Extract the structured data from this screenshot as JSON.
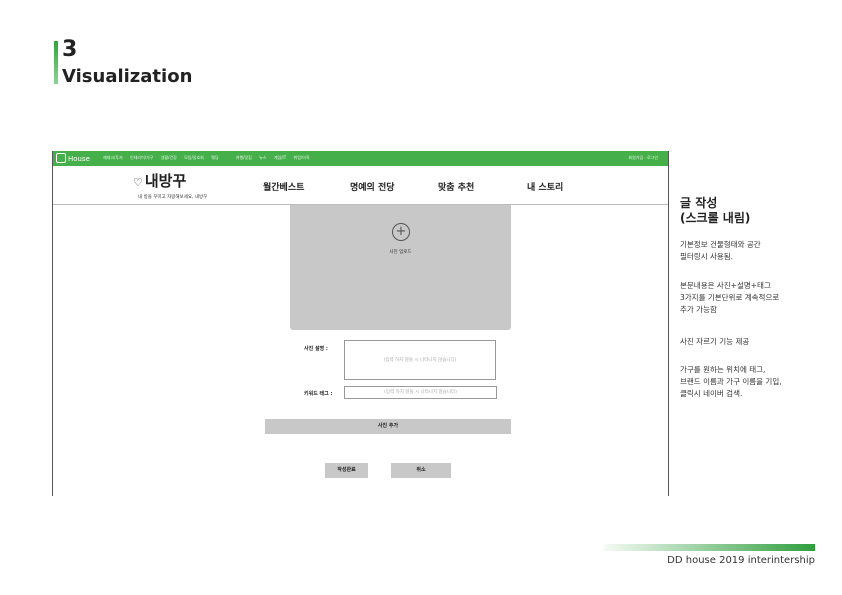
{
  "section": {
    "number": "3",
    "title": "Visualization"
  },
  "topbar": {
    "logo": "House",
    "menu": [
      "재테크/투자",
      "인테리어/가구",
      "생활/건강",
      "모임/동호회",
      "웨딩",
      "여행/맛집",
      "뉴스",
      "게임/IT",
      "취업/이직"
    ],
    "right": "회원가입 · 로그인"
  },
  "nav": {
    "brand": "내방꾸",
    "brand_icon": "♡",
    "tagline": "내 방을 꾸미고 자랑해보세요, 내방꾸",
    "items": [
      "월간베스트",
      "명예의 전당",
      "맞춤 추천",
      "내 스토리"
    ]
  },
  "upload": {
    "label": "사진 업로드"
  },
  "form": {
    "desc_label": "사진 설명 :",
    "desc_placeholder": "(입력 하지 않을 시 나타나지 않습니다)",
    "kw_label": "키워드 태그 :",
    "kw_placeholder": "(입력 하지 않을 시 나타나지 않습니다)",
    "add_photo": "사진 추가",
    "submit": "작성완료",
    "cancel": "취소"
  },
  "sidebar": {
    "title": "글 작성\n(스크롤 내림)",
    "notes": [
      "기본정보 건물형태와 공간\n필터링시 사용됨.",
      "본문내용은 사진+설명+태그\n3가지를 기본단위로 계속적으로\n추가 가능함",
      "사진 자르기 기능 제공",
      "가구를 원하는 위치에 태그,\n브랜드 이름과 가구 이름을 기입,\n클릭시 네이버 검색."
    ]
  },
  "footer": {
    "text": "DD house 2019 interintership"
  },
  "colors": {
    "accent": "#45b04a",
    "placeholder_gray": "#c8c8c8"
  }
}
